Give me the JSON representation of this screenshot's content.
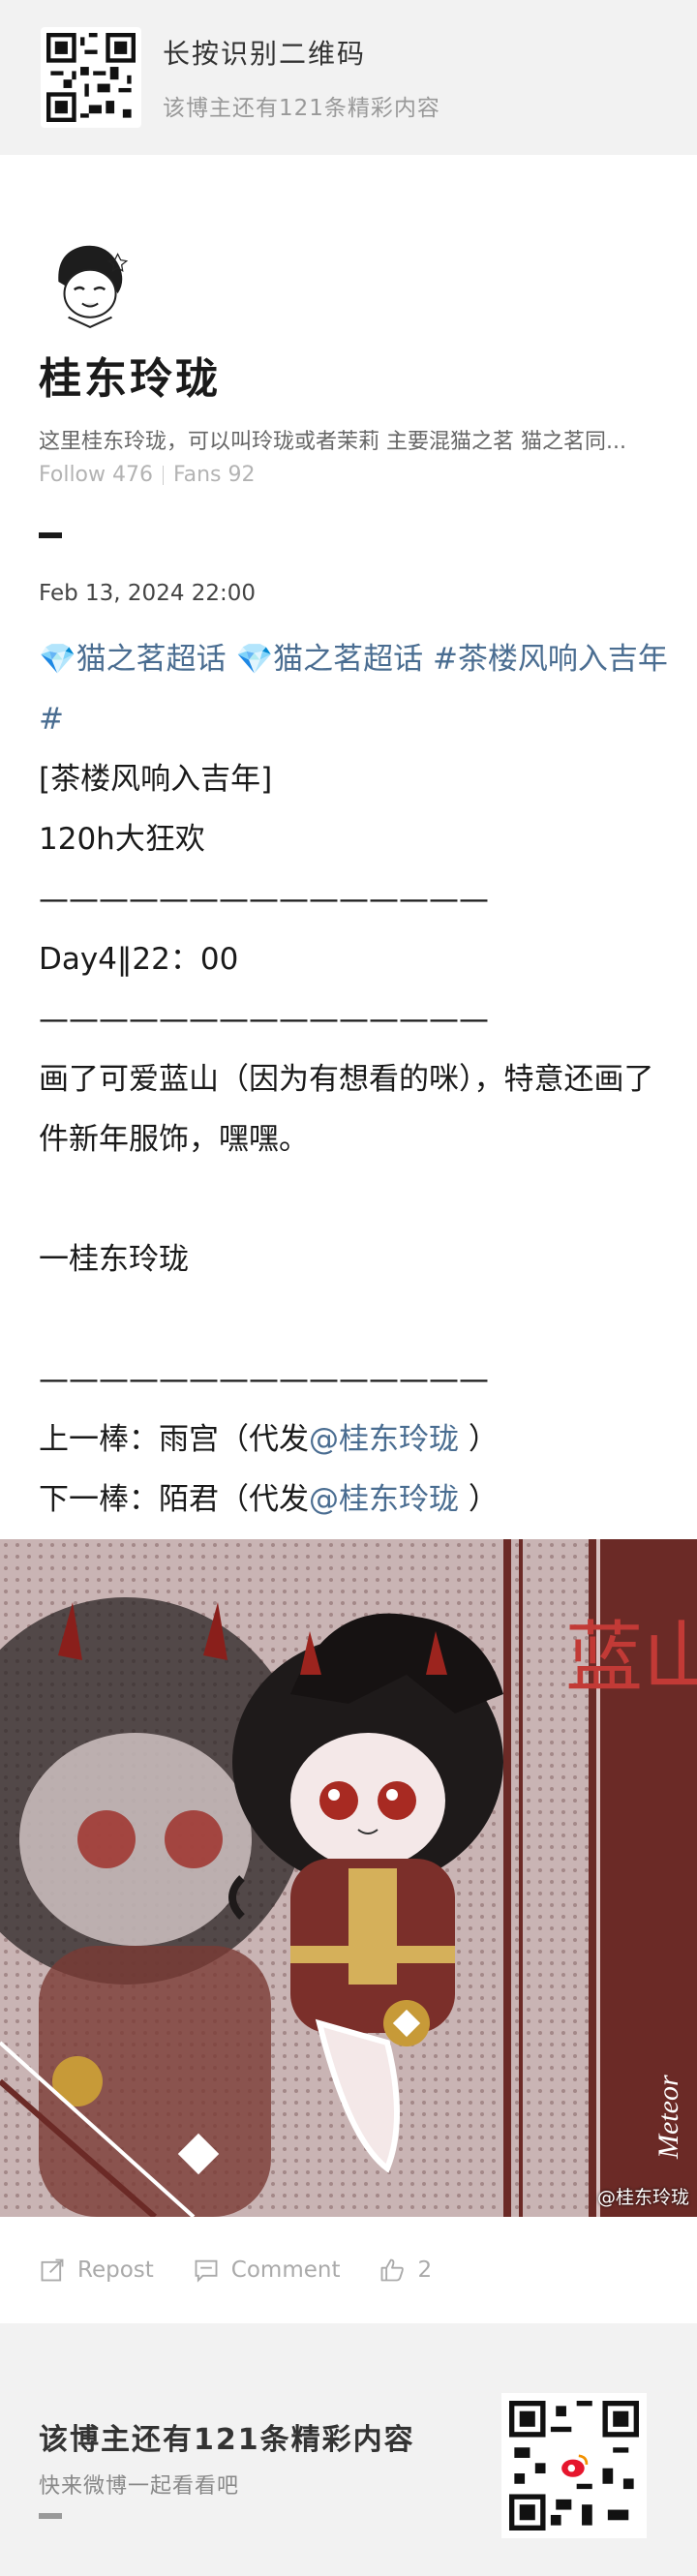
{
  "top_banner": {
    "title": "长按识别二维码",
    "subtitle": "该博主还有121条精彩内容"
  },
  "profile": {
    "name": "桂东玲珑",
    "bio": "这里桂东玲珑，可以叫玲珑或者茉莉 主要混猫之茗 猫之茗同...",
    "follow": "Follow 476",
    "fans": "Fans 92"
  },
  "post": {
    "date": "Feb 13, 2024 22:00",
    "tags": [
      "💎猫之茗超话",
      "💎猫之茗超话",
      "#茶楼风响入吉年#"
    ],
    "lines": [
      "[茶楼风响入吉年]",
      "120h大狂欢",
      "———————————————",
      "Day4‖22：00",
      "———————————————",
      "画了可爱蓝山（因为有想看的咪），特意还画了件新年服饰，嘿嘿。",
      "",
      "一桂东玲珑",
      "",
      "———————————————"
    ],
    "relay_prev_prefix": "上一棒：雨宫（代发",
    "relay_prev_mention": "@桂东玲珑",
    "relay_prev_suffix": "）",
    "relay_next_prefix": "下一棒：陌君（代发",
    "relay_next_mention": "@桂东玲珑",
    "relay_next_suffix": "）"
  },
  "artwork": {
    "vertical_title": "蓝山",
    "signature": "Meteor",
    "credit": "@桂东玲珑",
    "colors": {
      "bg": "#c9b4b4",
      "frame": "#6b2a26",
      "accent": "#b83a36"
    }
  },
  "actions": {
    "repost": "Repost",
    "comment": "Comment",
    "like_count": "2"
  },
  "bottom_banner": {
    "title": "该博主还有121条精彩内容",
    "subtitle": "快来微博一起看看吧"
  }
}
